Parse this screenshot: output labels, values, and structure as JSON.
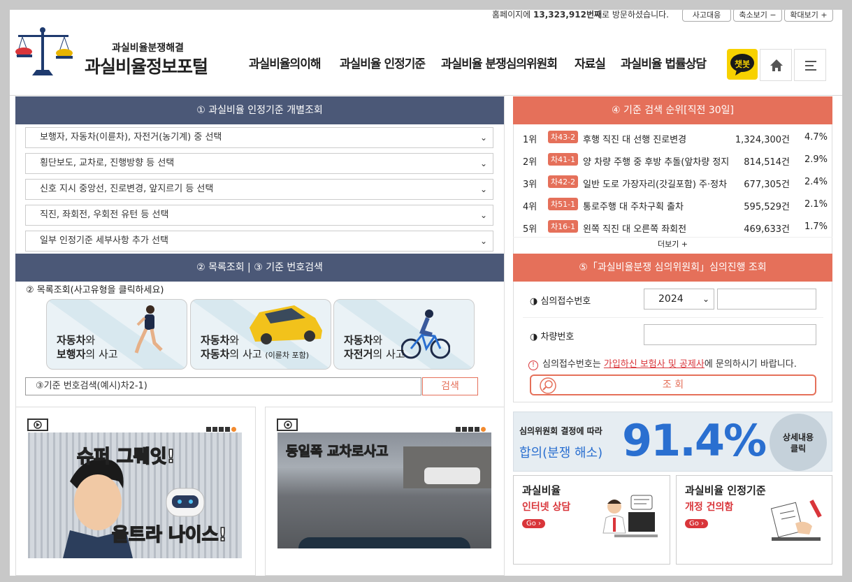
{
  "header": {
    "visit_prefix": "홈페이지에",
    "visit_count": "13,323,912번째",
    "visit_suffix": "로 방문하셨습니다.",
    "util_buttons": [
      "사고대응",
      "축소보기 −",
      "확대보기 +"
    ],
    "logo_sub": "과실비율분쟁해결",
    "logo_main": "과실비율정보포털",
    "nav": [
      "과실비율의이해",
      "과실비율 인정기준",
      "과실비율 분쟁심의위원회",
      "자료실",
      "과실비율 법률상담"
    ],
    "chatbot_label": "챗봇"
  },
  "section1": {
    "title": "① 과실비율 인정기준 개별조회",
    "selects": [
      "보행자, 자동차(이륜차), 자전거(농기계) 중 선택",
      "횡단보도, 교차로, 진행방향 등 선택",
      "신호 지시 중앙선, 진로변경, 앞지르기 등 선택",
      "직진, 좌회전, 우회전 유턴 등 선택",
      "일부 인정기준 세부사항 추가 선택"
    ]
  },
  "section2": {
    "title": "② 목록조회 | ③ 기준 번호검색",
    "list_label": "② 목록조회(사고유형을 클릭하세요)",
    "cards": [
      {
        "l1a": "자동차",
        "l1b": "와",
        "l2a": "보행자",
        "l2b": "의 사고",
        "l2c": ""
      },
      {
        "l1a": "자동차",
        "l1b": "와",
        "l2a": "자동차",
        "l2b": "의 사고",
        "l2c": "(이륜차 포함)"
      },
      {
        "l1a": "자동차",
        "l1b": "와",
        "l2a": "자전거",
        "l2b": "의 사고",
        "l2c": ""
      }
    ],
    "search_placeholder": "③기준 번호검색(예시)차2-1)",
    "search_button": "검색"
  },
  "ranking": {
    "title": "④ 기준 검색 순위[직전 30일]",
    "rows": [
      {
        "rank": "1위",
        "code": "차43-2",
        "title": "후행 직진 대 선행 진로변경",
        "count": "1,324,300건",
        "pct": "4.7%"
      },
      {
        "rank": "2위",
        "code": "차41-1",
        "title": "양 차량 주행 중 후방 추돌(앞차량 정지",
        "count": "814,514건",
        "pct": "2.9%"
      },
      {
        "rank": "3위",
        "code": "차42-2",
        "title": "일반 도로 가장자리(갓길포함) 주·정차",
        "count": "677,305건",
        "pct": "2.4%"
      },
      {
        "rank": "4위",
        "code": "차51-1",
        "title": "통로주행 대 주차구획 출차",
        "count": "595,529건",
        "pct": "2.1%"
      },
      {
        "rank": "5위",
        "code": "차16-1",
        "title": "왼쪽 직진 대 오른쪽 좌회전",
        "count": "469,633건",
        "pct": "1.7%"
      }
    ],
    "more": "더보기 +"
  },
  "committee": {
    "title": "⑤「과실비율분쟁 심의위원회」심의진행 조회",
    "receipt_label": "◑ 심의접수번호",
    "year": "2024",
    "car_label": "◑ 차량번호",
    "notice_pre": "심의접수번호는",
    "notice_link": "가입하신 보험사 및 공제사",
    "notice_post": "에 문의하시기 바랍니다.",
    "search_button": "조 회"
  },
  "stat": {
    "line1": "심의위원회 결정에 따라",
    "line2": "합의(분쟁 해소)",
    "value": "91.4%",
    "detail1": "상세내용",
    "detail2": "클릭"
  },
  "videos": [
    {
      "caption_a": "슈퍼",
      "caption_b": "그뤠잇!",
      "caption_c": "울트라",
      "caption_d": "나이스!"
    },
    {
      "caption": "동일폭 교차로사고"
    }
  ],
  "promo": [
    {
      "title": "과실비율",
      "sub": "인터넷 상담",
      "go": "Go ›"
    },
    {
      "title": "과실비율 인정기준",
      "sub": "개정 건의함",
      "go": "Go ›"
    }
  ]
}
